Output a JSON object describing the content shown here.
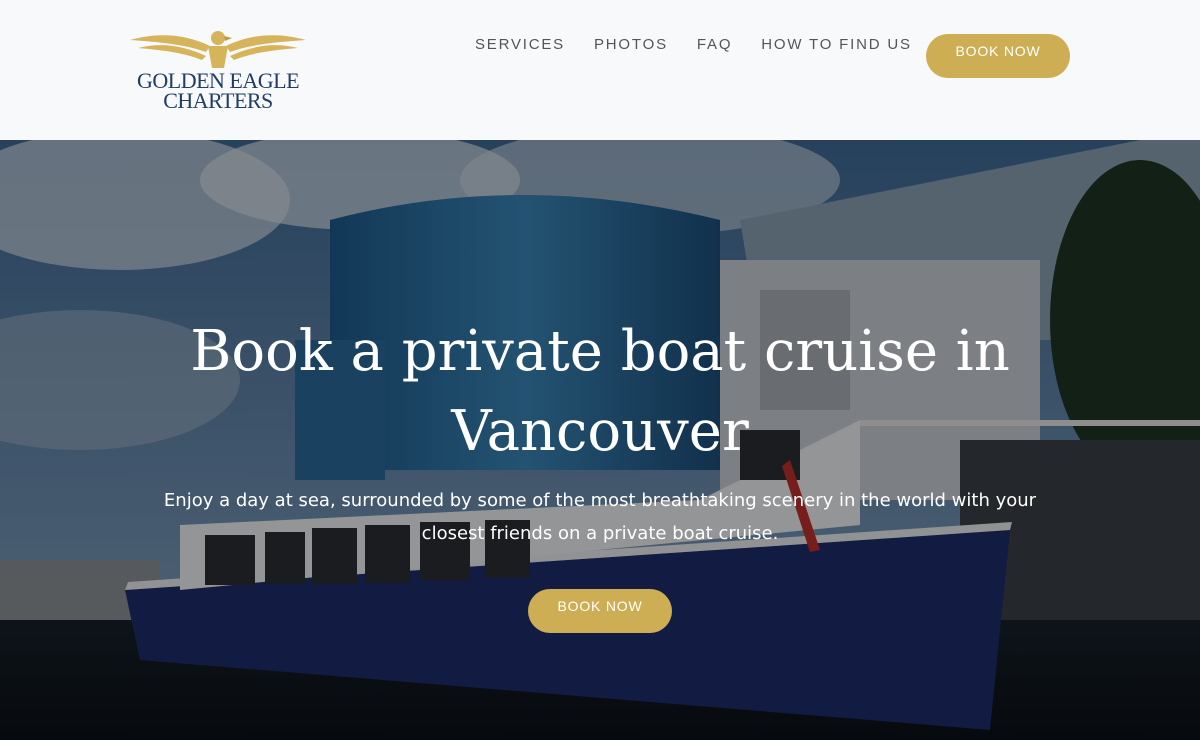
{
  "brand": {
    "line1": "GOLDEN EAGLE",
    "line2": "CHARTERS",
    "colors": {
      "gold": "#cdae55",
      "navy": "#1f3d66"
    }
  },
  "nav": {
    "items": [
      {
        "label": "SERVICES"
      },
      {
        "label": "PHOTOS"
      },
      {
        "label": "FAQ"
      },
      {
        "label": "HOW TO FIND US"
      }
    ],
    "book_label": "BOOK NOW"
  },
  "hero": {
    "title": "Book a private boat cruise in Vancouver",
    "subtitle": "Enjoy a day at sea, surrounded by some of the most breathtaking scenery in the world with your closest friends on a private boat cruise.",
    "button_label": "BOOK NOW"
  }
}
